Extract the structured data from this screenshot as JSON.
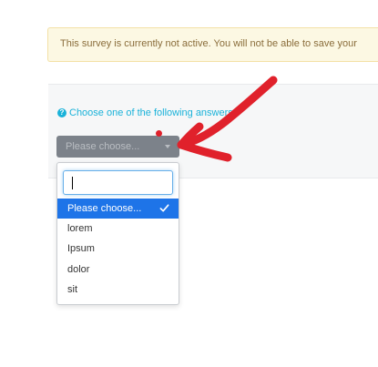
{
  "alert": {
    "text": "This survey is currently not active. You will not be able to save your"
  },
  "question": {
    "icon": "help-circle-icon",
    "text": "Choose one of the following answers"
  },
  "select": {
    "value": "Please choose...",
    "caret_icon": "caret-down-icon"
  },
  "dropdown": {
    "search_value": "",
    "options": [
      {
        "label": "Please choose...",
        "selected": true
      },
      {
        "label": "lorem",
        "selected": false
      },
      {
        "label": "Ipsum",
        "selected": false
      },
      {
        "label": "dolor",
        "selected": false
      },
      {
        "label": "sit",
        "selected": false
      }
    ],
    "check_icon": "check-icon"
  },
  "annotation": {
    "arrow_color": "#e0212b",
    "arrow_icon": "hand-drawn-arrow",
    "dot_icon": "red-dot"
  },
  "colors": {
    "alert_bg": "#fcf8e3",
    "alert_text": "#8a6d3b",
    "question_text": "#1ab2d9",
    "select_bg": "#7c828a",
    "selected_bg": "#1e74e8"
  }
}
